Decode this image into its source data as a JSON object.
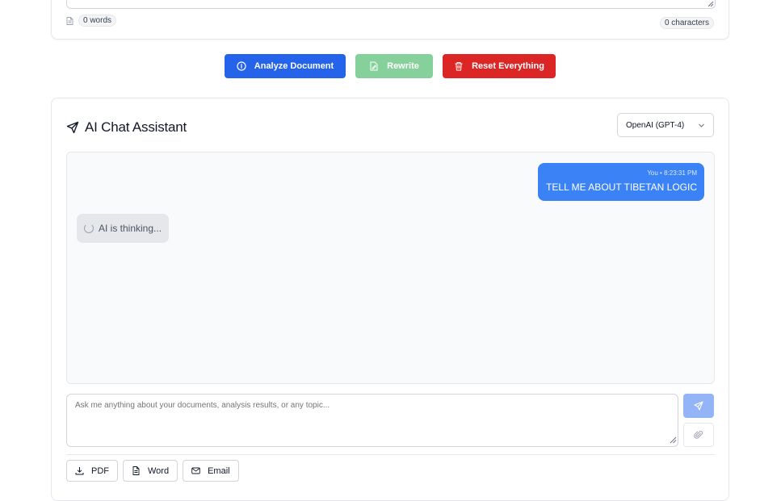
{
  "top_card": {
    "word_count": "0 words",
    "char_count": "0 characters"
  },
  "actions": {
    "analyze_label": "Analyze Document",
    "rewrite_label": "Rewrite",
    "reset_label": "Reset Everything"
  },
  "chat": {
    "title": "AI Chat Assistant",
    "model_selected": "OpenAI (GPT-4)",
    "messages": [
      {
        "sender": "You",
        "time": "8:23:31 PM",
        "meta": "You • 8:23:31 PM",
        "text": "TELL ME ABOUT TIBETAN LOGIC"
      }
    ],
    "thinking_text": "AI is thinking...",
    "input_placeholder": "Ask me anything about your documents, analysis results, or any topic...",
    "export": {
      "pdf_label": "PDF",
      "word_label": "Word",
      "email_label": "Email"
    }
  },
  "colors": {
    "primary_blue": "#2563eb",
    "user_bubble": "#3b82f6",
    "rewrite_green": "#86d19b",
    "reset_red": "#dc2626",
    "send_disabled": "#93b4f7"
  },
  "icons": {
    "word_count": "document-icon",
    "analyze": "info-circle-icon",
    "rewrite": "file-edit-icon",
    "reset": "trash-icon",
    "chat_title": "send-plane-icon",
    "model_dropdown": "chevron-down-icon",
    "thinking": "spinner-icon",
    "send": "send-icon",
    "attach": "paperclip-icon",
    "pdf": "download-icon",
    "word": "file-text-icon",
    "email": "mail-icon"
  }
}
